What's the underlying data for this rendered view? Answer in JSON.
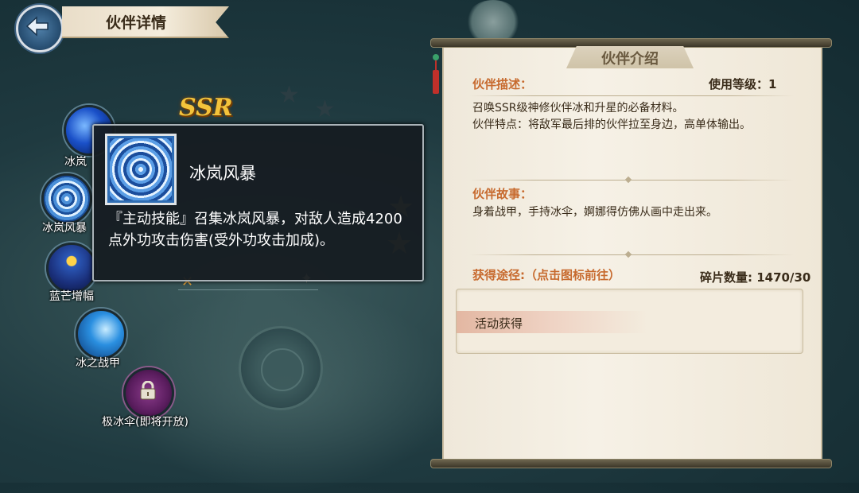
{
  "header": {
    "title": "伙伴详情"
  },
  "hero": {
    "rarity": "SSR"
  },
  "skills": [
    {
      "label": "冰岚",
      "locked": false
    },
    {
      "label": "冰岚风暴",
      "locked": false
    },
    {
      "label": "蓝芒增幅",
      "locked": false
    },
    {
      "label": "冰之战甲",
      "locked": false
    },
    {
      "label": "极冰伞(即将开放)",
      "locked": true
    }
  ],
  "tooltip": {
    "name": "冰岚风暴",
    "description": "『主动技能』召集冰岚风暴，对敌人造成4200点外功攻击伤害(受外功攻击加成)。"
  },
  "panel": {
    "title": "伙伴介绍",
    "description_label": "伙伴描述：",
    "level_label": "使用等级：1",
    "description_lines": [
      "召唤SSR级神修伙伴冰和升星的必备材料。",
      "伙伴特点：将敌军最后排的伙伴拉至身边，高单体输出。"
    ],
    "story_label": "伙伴故事：",
    "story_text": "身着战甲，手持冰伞，婀娜得仿佛从画中走出来。",
    "obtain_label": "获得途径:（点击图标前往）",
    "fragment_label": "碎片数量: 1470/30",
    "sources": [
      "活动获得"
    ]
  },
  "colors": {
    "accent": "#c76a2e",
    "tooltip_bg": "#161c22",
    "paper": "#f6f1e6"
  }
}
